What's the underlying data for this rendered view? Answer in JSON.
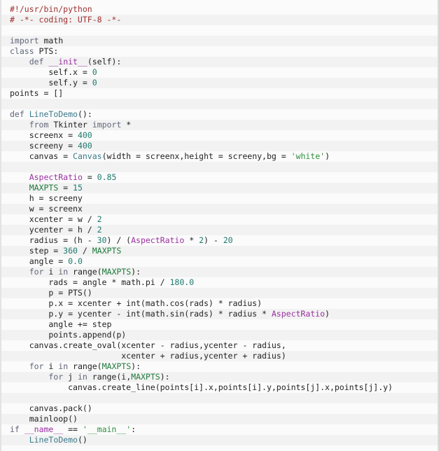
{
  "document": {
    "kind": "source-code-listing",
    "language": "Python",
    "font_size_px": 11.5,
    "line_height_px": 15,
    "colors": {
      "background": "#fbfbfb",
      "stripe": "#f2f2f2",
      "plain": "#222222",
      "comment": "#a03030",
      "keyword": "#60667a",
      "function": "#3c7a8c",
      "dunder": "#9b30a0",
      "variable": "#9b30a0",
      "number": "#1d7a6e",
      "string": "#2f8f3f",
      "constant": "#1f7a3c"
    }
  },
  "lines": [
    {
      "n": 1,
      "tokens": [
        {
          "t": "#!/usr/bin/python",
          "c": "comment"
        }
      ]
    },
    {
      "n": 2,
      "tokens": [
        {
          "t": "# -*- coding: UTF-8 -*-",
          "c": "comment"
        }
      ]
    },
    {
      "n": 3,
      "tokens": []
    },
    {
      "n": 4,
      "tokens": [
        {
          "t": "import",
          "c": "keyword"
        },
        {
          "t": " math",
          "c": "plain"
        }
      ]
    },
    {
      "n": 5,
      "tokens": [
        {
          "t": "class",
          "c": "keyword"
        },
        {
          "t": " PTS:",
          "c": "plain"
        }
      ]
    },
    {
      "n": 6,
      "tokens": [
        {
          "t": "    ",
          "c": "plain"
        },
        {
          "t": "def",
          "c": "keyword"
        },
        {
          "t": " ",
          "c": "plain"
        },
        {
          "t": "__init__",
          "c": "dunder"
        },
        {
          "t": "(self):",
          "c": "plain"
        }
      ]
    },
    {
      "n": 7,
      "tokens": [
        {
          "t": "        self.x = ",
          "c": "plain"
        },
        {
          "t": "0",
          "c": "number"
        }
      ]
    },
    {
      "n": 8,
      "tokens": [
        {
          "t": "        self.y = ",
          "c": "plain"
        },
        {
          "t": "0",
          "c": "number"
        }
      ]
    },
    {
      "n": 9,
      "tokens": [
        {
          "t": "points = []",
          "c": "plain"
        }
      ]
    },
    {
      "n": 10,
      "tokens": []
    },
    {
      "n": 11,
      "tokens": [
        {
          "t": "def",
          "c": "keyword"
        },
        {
          "t": " ",
          "c": "plain"
        },
        {
          "t": "LineToDemo",
          "c": "func"
        },
        {
          "t": "():",
          "c": "plain"
        }
      ]
    },
    {
      "n": 12,
      "tokens": [
        {
          "t": "    ",
          "c": "plain"
        },
        {
          "t": "from",
          "c": "keyword"
        },
        {
          "t": " Tkinter ",
          "c": "plain"
        },
        {
          "t": "import",
          "c": "keyword"
        },
        {
          "t": " *",
          "c": "plain"
        }
      ]
    },
    {
      "n": 13,
      "tokens": [
        {
          "t": "    screenx = ",
          "c": "plain"
        },
        {
          "t": "400",
          "c": "number"
        }
      ]
    },
    {
      "n": 14,
      "tokens": [
        {
          "t": "    screeny = ",
          "c": "plain"
        },
        {
          "t": "400",
          "c": "number"
        }
      ]
    },
    {
      "n": 15,
      "tokens": [
        {
          "t": "    canvas = ",
          "c": "plain"
        },
        {
          "t": "Canvas",
          "c": "func"
        },
        {
          "t": "(width = screenx,height = screeny,bg = ",
          "c": "plain"
        },
        {
          "t": "'white'",
          "c": "string"
        },
        {
          "t": ")",
          "c": "plain"
        }
      ]
    },
    {
      "n": 16,
      "tokens": []
    },
    {
      "n": 17,
      "tokens": [
        {
          "t": "    ",
          "c": "plain"
        },
        {
          "t": "AspectRatio",
          "c": "var"
        },
        {
          "t": " = ",
          "c": "plain"
        },
        {
          "t": "0.85",
          "c": "number"
        }
      ]
    },
    {
      "n": 18,
      "tokens": [
        {
          "t": "    ",
          "c": "plain"
        },
        {
          "t": "MAXPTS",
          "c": "const"
        },
        {
          "t": " = ",
          "c": "plain"
        },
        {
          "t": "15",
          "c": "number"
        }
      ]
    },
    {
      "n": 19,
      "tokens": [
        {
          "t": "    h = screeny",
          "c": "plain"
        }
      ]
    },
    {
      "n": 20,
      "tokens": [
        {
          "t": "    w = screenx",
          "c": "plain"
        }
      ]
    },
    {
      "n": 21,
      "tokens": [
        {
          "t": "    xcenter = w / ",
          "c": "plain"
        },
        {
          "t": "2",
          "c": "number"
        }
      ]
    },
    {
      "n": 22,
      "tokens": [
        {
          "t": "    ycenter = h / ",
          "c": "plain"
        },
        {
          "t": "2",
          "c": "number"
        }
      ]
    },
    {
      "n": 23,
      "tokens": [
        {
          "t": "    radius = (h - ",
          "c": "plain"
        },
        {
          "t": "30",
          "c": "number"
        },
        {
          "t": ") / (",
          "c": "plain"
        },
        {
          "t": "AspectRatio",
          "c": "var"
        },
        {
          "t": " * ",
          "c": "plain"
        },
        {
          "t": "2",
          "c": "number"
        },
        {
          "t": ") - ",
          "c": "plain"
        },
        {
          "t": "20",
          "c": "number"
        }
      ]
    },
    {
      "n": 24,
      "tokens": [
        {
          "t": "    step = ",
          "c": "plain"
        },
        {
          "t": "360",
          "c": "number"
        },
        {
          "t": " / ",
          "c": "plain"
        },
        {
          "t": "MAXPTS",
          "c": "const"
        }
      ]
    },
    {
      "n": 25,
      "tokens": [
        {
          "t": "    angle = ",
          "c": "plain"
        },
        {
          "t": "0.0",
          "c": "number"
        }
      ]
    },
    {
      "n": 26,
      "tokens": [
        {
          "t": "    ",
          "c": "plain"
        },
        {
          "t": "for",
          "c": "keyword"
        },
        {
          "t": " i ",
          "c": "plain"
        },
        {
          "t": "in",
          "c": "keyword"
        },
        {
          "t": " range(",
          "c": "plain"
        },
        {
          "t": "MAXPTS",
          "c": "const"
        },
        {
          "t": "):",
          "c": "plain"
        }
      ]
    },
    {
      "n": 27,
      "tokens": [
        {
          "t": "        rads = angle * math.pi / ",
          "c": "plain"
        },
        {
          "t": "180.0",
          "c": "number"
        }
      ]
    },
    {
      "n": 28,
      "tokens": [
        {
          "t": "        p = PTS()",
          "c": "plain"
        }
      ]
    },
    {
      "n": 29,
      "tokens": [
        {
          "t": "        p.x = xcenter + int(math.cos(rads) * radius)",
          "c": "plain"
        }
      ]
    },
    {
      "n": 30,
      "tokens": [
        {
          "t": "        p.y = ycenter - int(math.sin(rads) * radius * ",
          "c": "plain"
        },
        {
          "t": "AspectRatio",
          "c": "var"
        },
        {
          "t": ")",
          "c": "plain"
        }
      ]
    },
    {
      "n": 31,
      "tokens": [
        {
          "t": "        angle += step",
          "c": "plain"
        }
      ]
    },
    {
      "n": 32,
      "tokens": [
        {
          "t": "        points.append(p)",
          "c": "plain"
        }
      ]
    },
    {
      "n": 33,
      "tokens": [
        {
          "t": "    canvas.create_oval(xcenter - radius,ycenter - radius,",
          "c": "plain"
        }
      ]
    },
    {
      "n": 34,
      "tokens": [
        {
          "t": "                       xcenter + radius,ycenter + radius)",
          "c": "plain"
        }
      ]
    },
    {
      "n": 35,
      "tokens": [
        {
          "t": "    ",
          "c": "plain"
        },
        {
          "t": "for",
          "c": "keyword"
        },
        {
          "t": " i ",
          "c": "plain"
        },
        {
          "t": "in",
          "c": "keyword"
        },
        {
          "t": " range(",
          "c": "plain"
        },
        {
          "t": "MAXPTS",
          "c": "const"
        },
        {
          "t": "):",
          "c": "plain"
        }
      ]
    },
    {
      "n": 36,
      "tokens": [
        {
          "t": "        ",
          "c": "plain"
        },
        {
          "t": "for",
          "c": "keyword"
        },
        {
          "t": " j ",
          "c": "plain"
        },
        {
          "t": "in",
          "c": "keyword"
        },
        {
          "t": " range(i,",
          "c": "plain"
        },
        {
          "t": "MAXPTS",
          "c": "const"
        },
        {
          "t": "):",
          "c": "plain"
        }
      ]
    },
    {
      "n": 37,
      "tokens": [
        {
          "t": "            canvas.create_line(points[i].x,points[i].y,points[j].x,points[j].y)",
          "c": "plain"
        }
      ]
    },
    {
      "n": 38,
      "tokens": []
    },
    {
      "n": 39,
      "tokens": [
        {
          "t": "    canvas.pack()",
          "c": "plain"
        }
      ]
    },
    {
      "n": 40,
      "tokens": [
        {
          "t": "    mainloop()",
          "c": "plain"
        }
      ]
    },
    {
      "n": 41,
      "tokens": [
        {
          "t": "if",
          "c": "keyword"
        },
        {
          "t": " ",
          "c": "plain"
        },
        {
          "t": "__name__",
          "c": "dunder"
        },
        {
          "t": " == ",
          "c": "plain"
        },
        {
          "t": "'__main__'",
          "c": "string"
        },
        {
          "t": ":",
          "c": "plain"
        }
      ]
    },
    {
      "n": 42,
      "tokens": [
        {
          "t": "    ",
          "c": "plain"
        },
        {
          "t": "LineToDemo",
          "c": "func"
        },
        {
          "t": "()",
          "c": "plain"
        }
      ]
    }
  ]
}
